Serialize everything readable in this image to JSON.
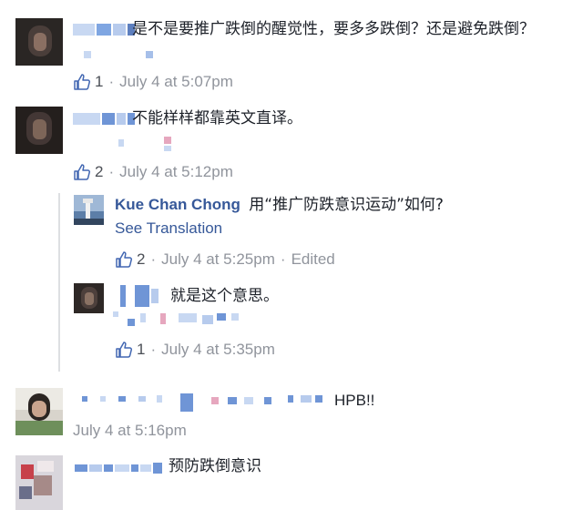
{
  "comments": [
    {
      "text": "是不是要推广跌倒的醒觉性，要多多跌倒？还是避免跌倒？",
      "likes": "1",
      "time": "July 4 at 5:07pm"
    },
    {
      "text": "不能样样都靠英文直译。",
      "likes": "2",
      "time": "July 4 at 5:12pm"
    },
    {
      "author": "Kue Chan Chong",
      "text": "用“推广防跌意识运动”如何?",
      "see_translation": "See Translation",
      "likes": "2",
      "time": "July 4 at 5:25pm",
      "edited": "Edited"
    },
    {
      "text": "就是这个意思。",
      "likes": "1",
      "time": "July 4 at 5:35pm"
    },
    {
      "text": "HPB!!",
      "time": "July 4 at 5:16pm"
    },
    {
      "text": "预防跌倒意识"
    }
  ],
  "separator_dot": "·",
  "colors": {
    "link": "#365899",
    "meta": "#90949c",
    "text": "#1d2129",
    "blur_blue": "#8fb3e8"
  },
  "icons": {
    "like": "thumbs-up-outline-icon"
  }
}
